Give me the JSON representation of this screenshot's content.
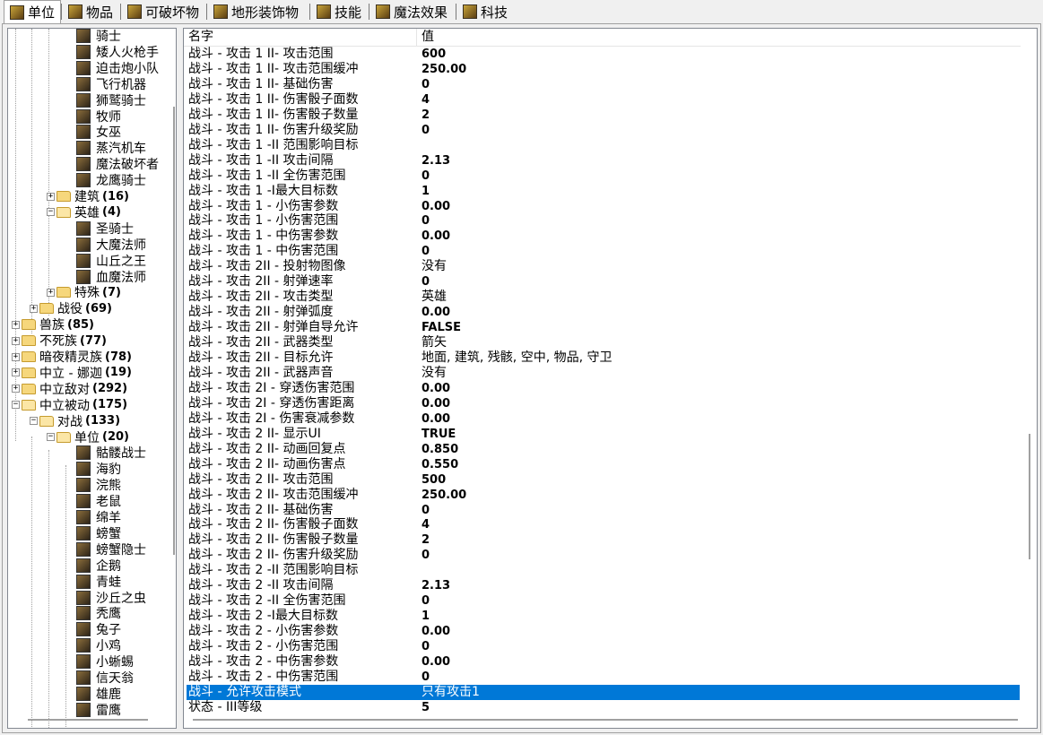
{
  "tabs": [
    {
      "label": "单位",
      "icon": "unit-tab-icon",
      "active": true
    },
    {
      "label": "物品",
      "icon": "item-tab-icon"
    },
    {
      "label": "可破坏物",
      "icon": "destructible-tab-icon"
    },
    {
      "label": "地形装饰物",
      "icon": "doodad-tab-icon"
    },
    {
      "label": "技能",
      "icon": "ability-tab-icon"
    },
    {
      "label": "魔法效果",
      "icon": "buff-tab-icon"
    },
    {
      "label": "科技",
      "icon": "upgrade-tab-icon"
    }
  ],
  "tree": {
    "units_top": [
      "骑士",
      "矮人火枪手",
      "迫击炮小队",
      "飞行机器",
      "狮鹫骑士",
      "牧师",
      "女巫",
      "蒸汽机车",
      "魔法破坏者",
      "龙鹰骑士"
    ],
    "building": {
      "label": "建筑",
      "count": "(16)"
    },
    "hero": {
      "label": "英雄",
      "count": "(4)"
    },
    "heroes": [
      "圣骑士",
      "大魔法师",
      "山丘之王",
      "血魔法师"
    ],
    "special": {
      "label": "特殊",
      "count": "(7)"
    },
    "campaign": {
      "label": "战役",
      "count": "(69)"
    },
    "races": [
      {
        "label": "兽族",
        "count": "(85)"
      },
      {
        "label": "不死族",
        "count": "(77)"
      },
      {
        "label": "暗夜精灵族",
        "count": "(78)"
      },
      {
        "label": "中立 - 娜迦",
        "count": "(19)"
      },
      {
        "label": "中立敌对",
        "count": "(292)"
      },
      {
        "label": "中立被动",
        "count": "(175)"
      }
    ],
    "melee": {
      "label": "对战",
      "count": "(133)"
    },
    "units_folder": {
      "label": "单位",
      "count": "(20)"
    },
    "passive_units": [
      "骷髅战士",
      "海豹",
      "浣熊",
      "老鼠",
      "绵羊",
      "螃蟹",
      "螃蟹隐士",
      "企鹅",
      "青蛙",
      "沙丘之虫",
      "秃鹰",
      "兔子",
      "小鸡",
      "小蜥蜴",
      "信天翁",
      "雄鹿",
      "雷鹰"
    ]
  },
  "list": {
    "header_name": "名字",
    "header_value": "值",
    "rows": [
      {
        "name": "战斗 - 攻击 1 II- 攻击范围",
        "value": "600"
      },
      {
        "name": "战斗 - 攻击 1 II- 攻击范围缓冲",
        "value": "250.00"
      },
      {
        "name": "战斗 - 攻击 1 II- 基础伤害",
        "value": "0"
      },
      {
        "name": "战斗 - 攻击 1 II- 伤害骰子面数",
        "value": "4"
      },
      {
        "name": "战斗 - 攻击 1 II- 伤害骰子数量",
        "value": "2"
      },
      {
        "name": "战斗 - 攻击 1 II- 伤害升级奖励",
        "value": "0"
      },
      {
        "name": "战斗 - 攻击 1 -II 范围影响目标",
        "value": ""
      },
      {
        "name": "战斗 - 攻击 1 -II 攻击间隔",
        "value": "2.13"
      },
      {
        "name": "战斗 - 攻击 1 -II 全伤害范围",
        "value": "0"
      },
      {
        "name": "战斗 - 攻击 1 -I最大目标数",
        "value": "1"
      },
      {
        "name": "战斗 - 攻击 1 - 小伤害参数",
        "value": "0.00"
      },
      {
        "name": "战斗 - 攻击 1 - 小伤害范围",
        "value": "0"
      },
      {
        "name": "战斗 - 攻击 1 - 中伤害参数",
        "value": "0.00"
      },
      {
        "name": "战斗 - 攻击 1 - 中伤害范围",
        "value": "0"
      },
      {
        "name": "战斗 - 攻击 2II - 投射物图像",
        "value": "没有"
      },
      {
        "name": "战斗 - 攻击 2II - 射弹速率",
        "value": "0"
      },
      {
        "name": "战斗 - 攻击 2II - 攻击类型",
        "value": "英雄"
      },
      {
        "name": "战斗 - 攻击 2II - 射弹弧度",
        "value": "0.00"
      },
      {
        "name": "战斗 - 攻击 2II - 射弹自导允许",
        "value": "FALSE"
      },
      {
        "name": "战斗 - 攻击 2II - 武器类型",
        "value": "箭矢"
      },
      {
        "name": "战斗 - 攻击 2II - 目标允许",
        "value": "地面, 建筑, 残骸, 空中, 物品, 守卫"
      },
      {
        "name": "战斗 - 攻击 2II - 武器声音",
        "value": "没有"
      },
      {
        "name": "战斗 - 攻击 2I - 穿透伤害范围",
        "value": "0.00"
      },
      {
        "name": "战斗 - 攻击 2I - 穿透伤害距离",
        "value": "0.00"
      },
      {
        "name": "战斗 - 攻击 2I - 伤害衰减参数",
        "value": "0.00"
      },
      {
        "name": "战斗 - 攻击 2 II- 显示UI",
        "value": "TRUE"
      },
      {
        "name": "战斗 - 攻击 2 II- 动画回复点",
        "value": "0.850"
      },
      {
        "name": "战斗 - 攻击 2 II- 动画伤害点",
        "value": "0.550"
      },
      {
        "name": "战斗 - 攻击 2 II- 攻击范围",
        "value": "500"
      },
      {
        "name": "战斗 - 攻击 2 II- 攻击范围缓冲",
        "value": "250.00"
      },
      {
        "name": "战斗 - 攻击 2 II- 基础伤害",
        "value": "0"
      },
      {
        "name": "战斗 - 攻击 2 II- 伤害骰子面数",
        "value": "4"
      },
      {
        "name": "战斗 - 攻击 2 II- 伤害骰子数量",
        "value": "2"
      },
      {
        "name": "战斗 - 攻击 2 II- 伤害升级奖励",
        "value": "0"
      },
      {
        "name": "战斗 - 攻击 2 -II 范围影响目标",
        "value": ""
      },
      {
        "name": "战斗 - 攻击 2 -II 攻击间隔",
        "value": "2.13"
      },
      {
        "name": "战斗 - 攻击 2 -II 全伤害范围",
        "value": "0"
      },
      {
        "name": "战斗 - 攻击 2 -I最大目标数",
        "value": "1"
      },
      {
        "name": "战斗 - 攻击 2 - 小伤害参数",
        "value": "0.00"
      },
      {
        "name": "战斗 - 攻击 2 - 小伤害范围",
        "value": "0"
      },
      {
        "name": "战斗 - 攻击 2 - 中伤害参数",
        "value": "0.00"
      },
      {
        "name": "战斗 - 攻击 2 - 中伤害范围",
        "value": "0"
      },
      {
        "name": "战斗 - 允许攻击模式",
        "value": "只有攻击1",
        "selected": true
      },
      {
        "name": "状态 - III等级",
        "value": "5"
      }
    ]
  },
  "colors": {
    "selection": "#0078d7",
    "window_bg": "#f0f0f0"
  }
}
